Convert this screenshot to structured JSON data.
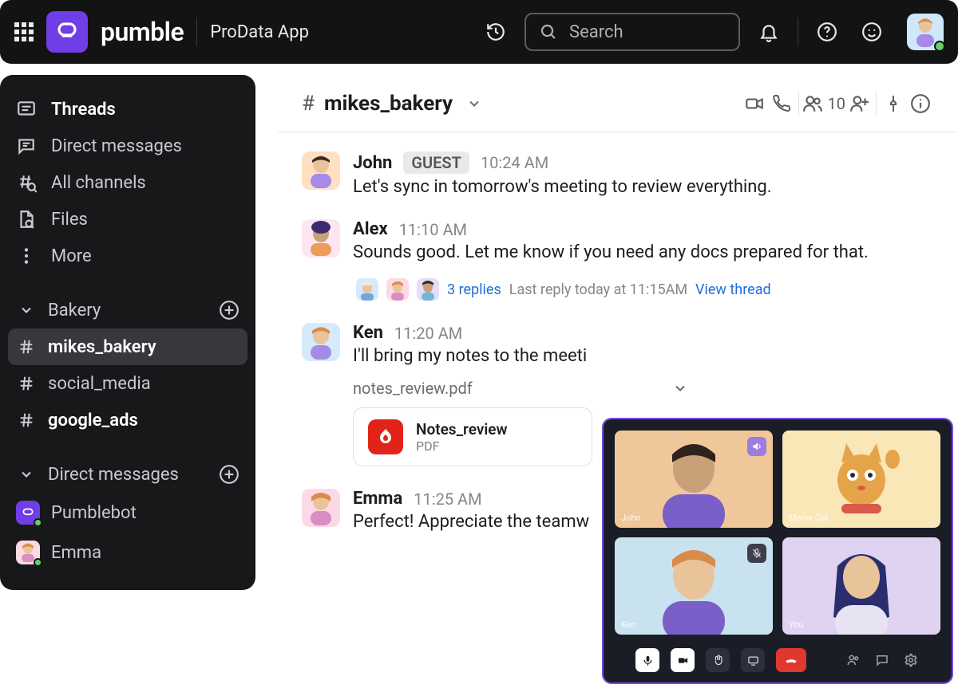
{
  "topbar": {
    "brand": "pumble",
    "workspace": "ProData App",
    "search_placeholder": "Search"
  },
  "sidebar": {
    "nav": {
      "threads": "Threads",
      "direct_messages": "Direct messages",
      "all_channels": "All channels",
      "files": "Files",
      "more": "More"
    },
    "sections": {
      "bakery": "Bakery",
      "dms": "Direct messages"
    },
    "channels": {
      "mikes_bakery": "mikes_bakery",
      "social_media": "social_media",
      "google_ads": "google_ads"
    },
    "dms": {
      "pumblebot": "Pumblebot",
      "emma": "Emma"
    }
  },
  "channel": {
    "hash": "#",
    "name": "mikes_bakery",
    "member_count": "10"
  },
  "messages": {
    "john": {
      "author": "John",
      "badge": "GUEST",
      "time": "10:24 AM",
      "text": "Let's sync in tomorrow's meeting to review everything."
    },
    "alex": {
      "author": "Alex",
      "time": "11:10 AM",
      "text": "Sounds good. Let me know if you need any docs prepared for that.",
      "replies": "3 replies",
      "last_reply": "Last reply today at 11:15AM",
      "view_thread": "View thread"
    },
    "ken": {
      "author": "Ken",
      "time": "11:20 AM",
      "text": "I'll bring my notes to the meeti",
      "file_chip": "notes_review.pdf",
      "file_title": "Notes_review",
      "file_type": "PDF"
    },
    "emma": {
      "author": "Emma",
      "time": "11:25 AM",
      "text": "Perfect! Appreciate the teamw"
    }
  },
  "call": {
    "tiles": {
      "john": "John",
      "meow": "Meow Cat",
      "ken": "Ken",
      "you": "You"
    }
  }
}
